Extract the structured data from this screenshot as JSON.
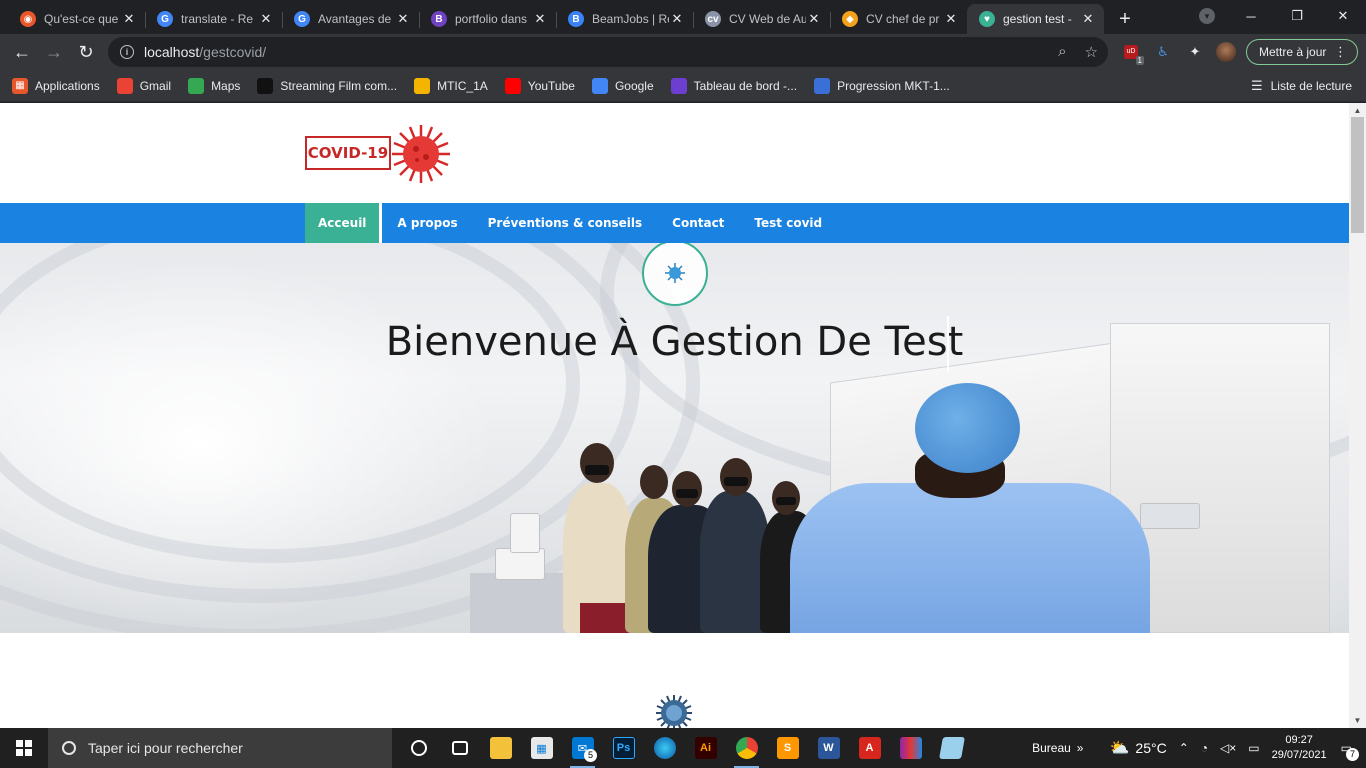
{
  "browser": {
    "tabs": [
      {
        "title": "Qu'est-ce que",
        "favicon_color": "#e8572b",
        "favicon_glyph": "◉"
      },
      {
        "title": "translate - Re",
        "favicon_color": "#4285f4",
        "favicon_glyph": "G"
      },
      {
        "title": "Avantages de",
        "favicon_color": "#4285f4",
        "favicon_glyph": "G"
      },
      {
        "title": "portfolio dans",
        "favicon_color": "#6f42c1",
        "favicon_glyph": "B"
      },
      {
        "title": "BeamJobs | Re",
        "favicon_color": "#3b82f6",
        "favicon_glyph": "B"
      },
      {
        "title": "CV Web de Au",
        "favicon_color": "#8a94a6",
        "favicon_glyph": "cv"
      },
      {
        "title": "CV chef de pr",
        "favicon_color": "#f2a31b",
        "favicon_glyph": "◆"
      },
      {
        "title": "gestion test -",
        "favicon_color": "#3ab095",
        "favicon_glyph": "♥",
        "active": true
      }
    ],
    "url_host": "localhost",
    "url_path": "/gestcovid/",
    "update_button": "Mettre à jour",
    "extension_badge": "1",
    "bookmarks": [
      {
        "label": "Applications",
        "icon": "apps-grid-icon",
        "color": "#e8572b"
      },
      {
        "label": "Gmail",
        "icon": "gmail-icon",
        "color": "#ea4335"
      },
      {
        "label": "Maps",
        "icon": "maps-icon",
        "color": "#34a853"
      },
      {
        "label": "Streaming Film com...",
        "icon": "film-icon",
        "color": "#111111"
      },
      {
        "label": "MTIC_1A",
        "icon": "classroom-icon",
        "color": "#f4b400"
      },
      {
        "label": "YouTube",
        "icon": "youtube-icon",
        "color": "#ff0000"
      },
      {
        "label": "Google",
        "icon": "google-icon",
        "color": "#4285f4"
      },
      {
        "label": "Tableau de bord -...",
        "icon": "dashboard-icon",
        "color": "#6c3fd1"
      },
      {
        "label": "Progression MKT-1...",
        "icon": "progress-icon",
        "color": "#3a6fd8"
      }
    ],
    "reading_list": "Liste de lecture"
  },
  "site": {
    "logo_text": "COVID-19",
    "nav": [
      {
        "label": "Acceuil",
        "active": true
      },
      {
        "label": "A propos"
      },
      {
        "label": "Préventions & conseils"
      },
      {
        "label": "Contact"
      },
      {
        "label": "Test covid"
      }
    ],
    "hero_title": "Bienvenue À Gestion De Test",
    "accent_color": "#3ab095",
    "nav_color": "#1a82e0"
  },
  "taskbar": {
    "search_placeholder": "Taper ici pour rechercher",
    "mail_badge": "5",
    "desktop_label": "Bureau",
    "temperature": "25°C",
    "time": "09:27",
    "date": "29/07/2021",
    "notifications": "7"
  }
}
